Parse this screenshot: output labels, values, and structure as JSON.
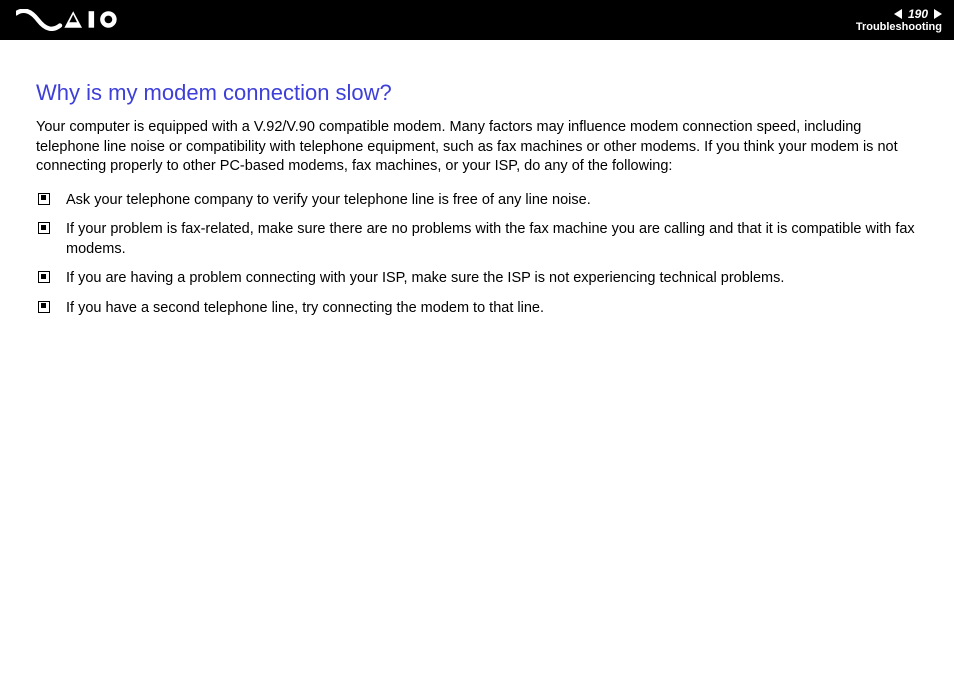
{
  "header": {
    "page_number": "190",
    "section": "Troubleshooting"
  },
  "content": {
    "title": "Why is my modem connection slow?",
    "intro": "Your computer is equipped with a V.92/V.90 compatible modem. Many factors may influence modem connection speed, including telephone line noise or compatibility with telephone equipment, such as fax machines or other modems. If you think your modem is not connecting properly to other PC-based modems, fax machines, or your ISP, do any of the following:",
    "bullets": [
      "Ask your telephone company to verify your telephone line is free of any line noise.",
      "If your problem is fax-related, make sure there are no problems with the fax machine you are calling and that it is compatible with fax modems.",
      "If you are having a problem connecting with your ISP, make sure the ISP is not experiencing technical problems.",
      "If you have a second telephone line, try connecting the modem to that line."
    ]
  }
}
